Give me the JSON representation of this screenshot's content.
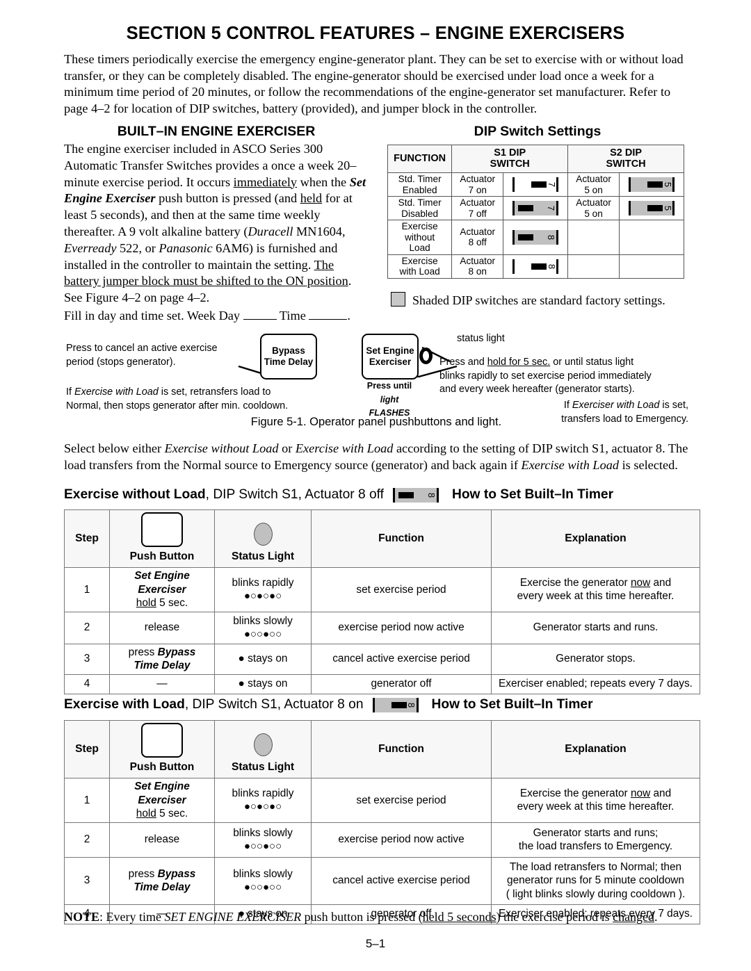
{
  "section_title": "SECTION 5  CONTROL FEATURES – ENGINE EXERCISERS",
  "intro": "These timers periodically exercise the emergency engine-generator plant.  They can be set to exercise with or without load transfer, or they can be completely disabled.  The engine-generator should be exercised under load once a week for a minimum time period of 20 minutes, or follow the recommendations of the engine-generator set manufacturer.  Refer to page 4–2 for location of DIP switches, battery (provided), and jumper block in the controller.",
  "built_in": {
    "heading": "BUILT–IN ENGINE EXERCISER",
    "p1_a": "The engine exerciser included in ASCO Series 300 Automatic Transfer Switches provides a once a week 20–minute exercise period.  It occurs ",
    "p1_immediately": "immediately",
    "p1_b": " when the ",
    "p1_set": "Set Engine Exerciser",
    "p1_c": " push button is pressed (and ",
    "p1_held": "held",
    "p1_d": " for at least 5 seconds), and then at the same time weekly thereafter.  A 9 volt alkaline battery (",
    "p1_duracell": "Duracell",
    "p1_e": " MN1604, ",
    "p1_everready": "Everready",
    "p1_f": " 522, or ",
    "p1_panasonic": "Panasonic",
    "p1_g": " 6AM6) is furnished and installed in the controller to maintain the setting.  ",
    "p1_jumper": "The battery jumper block must be shifted to the ON position",
    "p1_h": ".  See Figure 4–2 on page 4–2.",
    "fill_in_a": "Fill in day and time set.  Week Day ",
    "fill_in_b": " Time ",
    "fill_in_c": "."
  },
  "dip": {
    "title": "DIP Switch Settings",
    "headers": [
      "FUNCTION",
      "S1 DIP SWITCH",
      "S2 DIP SWITCH"
    ],
    "header_lines": {
      "function": "FUNCTION",
      "s1_l1": "S1 DIP",
      "s1_l2": "SWITCH",
      "s2_l1": "S2 DIP",
      "s2_l2": "SWITCH"
    },
    "rows": [
      {
        "function_l1": "Std. Timer",
        "function_l2": "Enabled",
        "s1_actuator_l1": "Actuator",
        "s1_actuator_l2": "7 on",
        "s1_switch": {
          "number": "7",
          "position": "on",
          "shaded": false
        },
        "s2_actuator_l1": "Actuator",
        "s2_actuator_l2": "5 on",
        "s2_switch": {
          "number": "5",
          "position": "on",
          "shaded": true
        }
      },
      {
        "function_l1": "Std. Timer",
        "function_l2": "Disabled",
        "s1_actuator_l1": "Actuator",
        "s1_actuator_l2": "7 off",
        "s1_switch": {
          "number": "7",
          "position": "off",
          "shaded": true
        },
        "s2_actuator_l1": "Actuator",
        "s2_actuator_l2": "5 on",
        "s2_switch": {
          "number": "5",
          "position": "on",
          "shaded": true
        }
      },
      {
        "function_l1": "Exercise",
        "function_l2": "without",
        "function_l3": "Load",
        "s1_actuator_l1": "Actuator",
        "s1_actuator_l2": "8 off",
        "s1_switch": {
          "number": "8",
          "position": "off",
          "shaded": true
        },
        "s2_actuator_l1": "",
        "s2_actuator_l2": "",
        "s2_switch": null
      },
      {
        "function_l1": "Exercise",
        "function_l2": "with Load",
        "s1_actuator_l1": "Actuator",
        "s1_actuator_l2": "8 on",
        "s1_switch": {
          "number": "8",
          "position": "on",
          "shaded": false
        },
        "s2_actuator_l1": "",
        "s2_actuator_l2": "",
        "s2_switch": null
      }
    ],
    "legend": "Shaded DIP switches are standard factory settings.",
    "shade_color": "#c8c8c8"
  },
  "figure": {
    "bypass_button_l1": "Bypass",
    "bypass_button_l2": "Time Delay",
    "set_button_l1": "Set Engine",
    "set_button_l2": "Exerciser",
    "press_until_l1": "Press until",
    "press_until_l2": "light  FLASHES",
    "status_light_label": "status light",
    "left_top_l1": "Press to cancel an active exercise",
    "left_top_l2": "period (stops generator).",
    "left_bot_a": "If ",
    "left_bot_i": "Exercise with Load",
    "left_bot_b": " is set, retransfers load to",
    "left_bot_l2": "Normal, then stops generator after min. cooldown.",
    "right_l1": "Press and ",
    "right_hold": "hold for 5 sec.",
    "right_l1b": " or until status light",
    "right_l2": "blinks rapidly to set exercise period immediately",
    "right_l3": "and every week hereafter (generator starts).",
    "right_b_a": "If ",
    "right_b_i": "Exerciser with Load",
    "right_b_b": " is set,",
    "right_b_l2": "transfers load to Emergency.",
    "caption": "Figure 5-1. Operator panel pushbuttons and light."
  },
  "select_para": {
    "a": "Select below either ",
    "i1": "Exercise without Load",
    "b": " or ",
    "i2": "Exercise with Load",
    "c": " according to the setting of DIP switch S1, actuator 8. The load transfers from the Normal source to Emergency source (generator) and back again if ",
    "i3": "Exercise with Load",
    "d": " is selected."
  },
  "tables": [
    {
      "heading_bold": "Exercise without Load",
      "heading_rest": ", DIP Switch S1, Actuator 8 off",
      "heading_switch": {
        "number": "8",
        "position": "off",
        "shaded": true
      },
      "heading_howto": "How to Set Built–In Timer",
      "columns": [
        "Step",
        "Push Button",
        "Status Light",
        "Function",
        "Explanation"
      ],
      "rows": [
        {
          "step": "1",
          "push_button_l1": "Set Engine",
          "push_button_l2": "Exerciser",
          "push_button_l3_u": "hold",
          "push_button_l3_rest": " 5 sec.",
          "status_label": "blinks rapidly",
          "status_dots": "●○●○●○",
          "function": "set exercise period",
          "explanation_l1a": "Exercise the generator ",
          "explanation_l1u": "now",
          "explanation_l1b": " and",
          "explanation_l2": "every week at this time hereafter."
        },
        {
          "step": "2",
          "push_button_plain": "release",
          "status_label": "blinks slowly",
          "status_dots": "●○○●○○",
          "function": "exercise period now active",
          "explanation_l1": "Generator starts and runs."
        },
        {
          "step": "3",
          "push_button_pre": "press ",
          "push_button_l1i": "Bypass",
          "push_button_l2i": "Time Delay",
          "status_stays": "● stays on",
          "function": "cancel active exercise period",
          "explanation_l1": "Generator stops."
        },
        {
          "step": "4",
          "push_button_plain": "—",
          "status_stays": "● stays on",
          "function": "generator off",
          "explanation_l1": "Exerciser enabled; repeats every 7 days."
        }
      ]
    },
    {
      "heading_bold": "Exercise with Load",
      "heading_rest": ", DIP Switch S1, Actuator 8 on",
      "heading_switch": {
        "number": "8",
        "position": "on",
        "shaded": true
      },
      "heading_howto": "How to Set Built–In Timer",
      "columns": [
        "Step",
        "Push Button",
        "Status Light",
        "Function",
        "Explanation"
      ],
      "rows": [
        {
          "step": "1",
          "push_button_l1": "Set Engine",
          "push_button_l2": "Exerciser",
          "push_button_l3_u": "hold",
          "push_button_l3_rest": " 5 sec.",
          "status_label": "blinks rapidly",
          "status_dots": "●○●○●○",
          "function": "set exercise period",
          "explanation_l1a": "Exercise the generator ",
          "explanation_l1u": "now",
          "explanation_l1b": " and",
          "explanation_l2": "every week at this time hereafter."
        },
        {
          "step": "2",
          "push_button_plain": "release",
          "status_label": "blinks slowly",
          "status_dots": "●○○●○○",
          "function": "exercise period now active",
          "explanation_l1": "Generator starts and runs;",
          "explanation_l2": "the load transfers to Emergency."
        },
        {
          "step": "3",
          "push_button_pre": "press ",
          "push_button_l1i": "Bypass",
          "push_button_l2i": "Time Delay",
          "status_label": "blinks slowly",
          "status_dots": "●○○●○○",
          "function": "cancel active exercise period",
          "explanation_l1": "The load retransfers to Normal; then",
          "explanation_l2": "generator runs for 5 minute cooldown",
          "explanation_l3": "( light blinks slowly during cooldown )."
        },
        {
          "step": "4",
          "push_button_plain": "—",
          "status_stays": "● stays on",
          "function": "generator off",
          "explanation_l1": "Exerciser enabled; repeats every 7 days."
        }
      ]
    }
  ],
  "note": {
    "label": "NOTE",
    "a": ": Every time ",
    "i": "SET ENGINE EXERCISER",
    "b": " push button is pressed (",
    "u1": "held 5 seconds",
    "c": ") the exercise period is ",
    "u2": "changed",
    "d": "."
  },
  "page_number": "5–1"
}
